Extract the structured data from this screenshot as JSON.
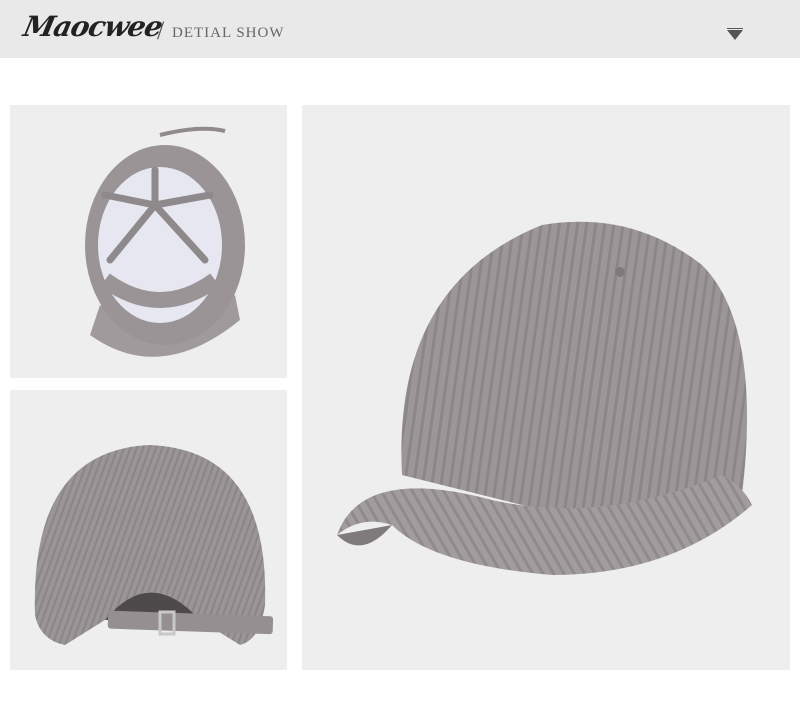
{
  "header": {
    "brand": "Maocwee",
    "subtitle": "DETIAL SHOW",
    "scroll_icon": "chevron-down-icon"
  },
  "photos": [
    {
      "view": "underside",
      "name": "cap-underside-photo"
    },
    {
      "view": "back",
      "name": "cap-back-photo"
    },
    {
      "view": "side",
      "name": "cap-side-photo"
    }
  ],
  "colors": {
    "header_bg": "#e9e9ea",
    "cap_gray": "#9b9597",
    "photo_bg": "#efeff0"
  }
}
